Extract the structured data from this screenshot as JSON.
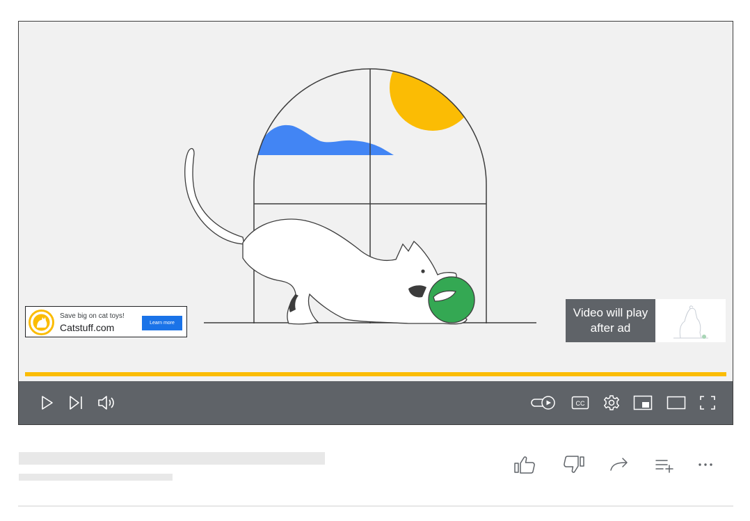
{
  "ad": {
    "tagline": "Save big on cat toys!",
    "domain": "Catstuff.com",
    "cta_label": "Learn more",
    "logo_icon": "cat-logo-icon",
    "cta_color": "#1a73e8",
    "logo_color": "#fbbc04"
  },
  "skip": {
    "message": "Video will play after ad",
    "thumbnail_icon": "dog-illustration-icon"
  },
  "progress": {
    "played_fraction": 1.0,
    "color": "#fbbc04"
  },
  "controls": {
    "left": [
      "play-icon",
      "next-icon",
      "volume-icon"
    ],
    "right": [
      "autoplay-toggle-icon",
      "captions-icon",
      "settings-icon",
      "miniplayer-icon",
      "theater-mode-icon",
      "fullscreen-icon"
    ],
    "captions_label": "CC",
    "bar_color": "#5f6368"
  },
  "actions": [
    "like-icon",
    "dislike-icon",
    "share-icon",
    "save-to-playlist-icon",
    "more-icon"
  ],
  "scene": {
    "colors": {
      "sky": "#4285f4",
      "sun": "#fbbc04",
      "ball": "#34a853"
    }
  }
}
